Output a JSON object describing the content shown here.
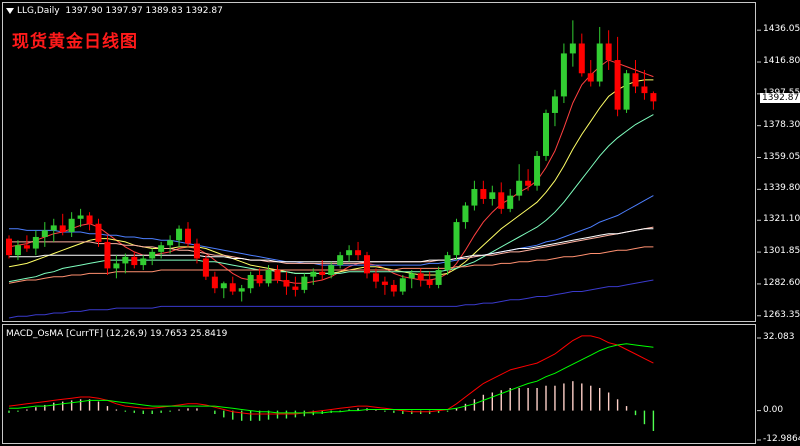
{
  "header": {
    "symbol_label": "LLG,Daily",
    "ohlc": "1397.90 1397.97 1389.83 1392.87",
    "chinese_title": "现货黄金日线图",
    "macd_label": "MACD_OsMA [CurrTF] (12,26,9) 19.7653 25.8419"
  },
  "current_price": "1392.87",
  "price_axis": [
    "1436.05",
    "1416.80",
    "1397.55",
    "1378.30",
    "1359.05",
    "1339.80",
    "1321.10",
    "1301.85",
    "1282.60",
    "1263.35"
  ],
  "macd_axis": [
    "32.083",
    "0.00",
    "-12.9864"
  ],
  "colors": {
    "background": "#000000",
    "bull": "#32cd32",
    "bear": "#ff0000",
    "border": "#c8c8c8"
  },
  "chart_data": {
    "type": "candlestick",
    "title": "",
    "ylim": [
      1263.35,
      1445
    ],
    "candles": [
      [
        1310,
        1312,
        1298,
        1300
      ],
      [
        1300,
        1309,
        1297,
        1306
      ],
      [
        1306,
        1312,
        1302,
        1304
      ],
      [
        1304,
        1315,
        1300,
        1311
      ],
      [
        1311,
        1320,
        1305,
        1315
      ],
      [
        1315,
        1322,
        1308,
        1318
      ],
      [
        1318,
        1325,
        1312,
        1314
      ],
      [
        1314,
        1326,
        1311,
        1322
      ],
      [
        1322,
        1328,
        1317,
        1324
      ],
      [
        1324,
        1326,
        1315,
        1319
      ],
      [
        1319,
        1322,
        1305,
        1308
      ],
      [
        1308,
        1312,
        1288,
        1292
      ],
      [
        1292,
        1300,
        1286,
        1295
      ],
      [
        1295,
        1301,
        1289,
        1299
      ],
      [
        1299,
        1302,
        1292,
        1294
      ],
      [
        1294,
        1300,
        1291,
        1298
      ],
      [
        1298,
        1304,
        1294,
        1302
      ],
      [
        1302,
        1308,
        1298,
        1306
      ],
      [
        1306,
        1312,
        1301,
        1309
      ],
      [
        1309,
        1318,
        1305,
        1316
      ],
      [
        1316,
        1320,
        1305,
        1307
      ],
      [
        1307,
        1310,
        1295,
        1298
      ],
      [
        1298,
        1300,
        1285,
        1287
      ],
      [
        1287,
        1290,
        1277,
        1280
      ],
      [
        1280,
        1284,
        1274,
        1283
      ],
      [
        1283,
        1287,
        1276,
        1278
      ],
      [
        1278,
        1282,
        1272,
        1280
      ],
      [
        1280,
        1290,
        1277,
        1288
      ],
      [
        1288,
        1292,
        1281,
        1283
      ],
      [
        1283,
        1294,
        1281,
        1291
      ],
      [
        1291,
        1294,
        1283,
        1285
      ],
      [
        1285,
        1290,
        1276,
        1281
      ],
      [
        1281,
        1287,
        1275,
        1279
      ],
      [
        1279,
        1289,
        1277,
        1287
      ],
      [
        1287,
        1292,
        1282,
        1290
      ],
      [
        1290,
        1297,
        1285,
        1288
      ],
      [
        1288,
        1296,
        1286,
        1294
      ],
      [
        1294,
        1302,
        1292,
        1300
      ],
      [
        1300,
        1306,
        1296,
        1303
      ],
      [
        1303,
        1308,
        1297,
        1300
      ],
      [
        1300,
        1302,
        1286,
        1289
      ],
      [
        1289,
        1292,
        1280,
        1284
      ],
      [
        1284,
        1287,
        1276,
        1282
      ],
      [
        1282,
        1285,
        1275,
        1278
      ],
      [
        1278,
        1288,
        1276,
        1286
      ],
      [
        1286,
        1291,
        1280,
        1289
      ],
      [
        1289,
        1292,
        1281,
        1285
      ],
      [
        1285,
        1290,
        1280,
        1282
      ],
      [
        1282,
        1293,
        1280,
        1291
      ],
      [
        1291,
        1302,
        1288,
        1300
      ],
      [
        1300,
        1322,
        1297,
        1320
      ],
      [
        1320,
        1332,
        1316,
        1330
      ],
      [
        1330,
        1345,
        1327,
        1340
      ],
      [
        1340,
        1345,
        1331,
        1334
      ],
      [
        1334,
        1342,
        1330,
        1338
      ],
      [
        1338,
        1344,
        1325,
        1328
      ],
      [
        1328,
        1340,
        1326,
        1336
      ],
      [
        1336,
        1355,
        1333,
        1345
      ],
      [
        1345,
        1352,
        1339,
        1342
      ],
      [
        1342,
        1363,
        1339,
        1360
      ],
      [
        1360,
        1388,
        1357,
        1386
      ],
      [
        1386,
        1400,
        1378,
        1396
      ],
      [
        1396,
        1428,
        1392,
        1422
      ],
      [
        1422,
        1442,
        1414,
        1428
      ],
      [
        1428,
        1434,
        1408,
        1410
      ],
      [
        1410,
        1418,
        1402,
        1405
      ],
      [
        1405,
        1438,
        1402,
        1428
      ],
      [
        1428,
        1436,
        1412,
        1418
      ],
      [
        1418,
        1432,
        1384,
        1388
      ],
      [
        1388,
        1412,
        1386,
        1410
      ],
      [
        1410,
        1418,
        1398,
        1402
      ],
      [
        1402,
        1412,
        1394,
        1398
      ],
      [
        1398,
        1399,
        1388,
        1393
      ]
    ],
    "moving_averages": [
      {
        "color": "#ff4040",
        "values": [
          1305,
          1306,
          1307,
          1309,
          1311,
          1313,
          1314,
          1316,
          1318,
          1319,
          1317,
          1313,
          1309,
          1305,
          1302,
          1300,
          1300,
          1301,
          1302,
          1304,
          1305,
          1304,
          1301,
          1297,
          1293,
          1289,
          1286,
          1285,
          1285,
          1285,
          1285,
          1284,
          1283,
          1283,
          1284,
          1285,
          1287,
          1290,
          1293,
          1295,
          1295,
          1294,
          1292,
          1289,
          1287,
          1286,
          1285,
          1285,
          1286,
          1289,
          1295,
          1303,
          1312,
          1320,
          1326,
          1331,
          1334,
          1338,
          1341,
          1345,
          1353,
          1363,
          1377,
          1392,
          1403,
          1409,
          1414,
          1418,
          1416,
          1414,
          1412,
          1410,
          1408
        ]
      },
      {
        "color": "#ffff66",
        "values": [
          1293,
          1294,
          1295,
          1297,
          1299,
          1301,
          1303,
          1305,
          1307,
          1309,
          1310,
          1310,
          1309,
          1308,
          1306,
          1305,
          1304,
          1304,
          1304,
          1305,
          1305,
          1305,
          1304,
          1302,
          1300,
          1298,
          1296,
          1294,
          1293,
          1292,
          1291,
          1290,
          1289,
          1289,
          1289,
          1289,
          1289,
          1290,
          1291,
          1292,
          1293,
          1293,
          1292,
          1291,
          1290,
          1289,
          1288,
          1288,
          1288,
          1289,
          1292,
          1296,
          1301,
          1306,
          1311,
          1316,
          1320,
          1324,
          1328,
          1332,
          1338,
          1345,
          1354,
          1364,
          1373,
          1381,
          1389,
          1396,
          1400,
          1403,
          1405,
          1406,
          1406
        ]
      },
      {
        "color": "#7fffbf",
        "values": [
          1284,
          1285,
          1286,
          1287,
          1289,
          1290,
          1292,
          1293,
          1294,
          1295,
          1296,
          1297,
          1297,
          1297,
          1297,
          1297,
          1297,
          1297,
          1297,
          1297,
          1297,
          1297,
          1296,
          1296,
          1295,
          1294,
          1293,
          1292,
          1291,
          1291,
          1290,
          1290,
          1289,
          1289,
          1289,
          1289,
          1289,
          1289,
          1290,
          1290,
          1290,
          1290,
          1290,
          1290,
          1290,
          1290,
          1290,
          1290,
          1290,
          1291,
          1292,
          1294,
          1296,
          1299,
          1302,
          1305,
          1308,
          1311,
          1314,
          1317,
          1321,
          1326,
          1332,
          1339,
          1346,
          1353,
          1360,
          1366,
          1371,
          1375,
          1379,
          1382,
          1385
        ]
      },
      {
        "color": "#4d7fff",
        "values": [
          1316,
          1316,
          1315,
          1315,
          1315,
          1315,
          1314,
          1314,
          1314,
          1313,
          1313,
          1312,
          1312,
          1311,
          1311,
          1310,
          1310,
          1309,
          1309,
          1308,
          1307,
          1306,
          1305,
          1304,
          1303,
          1302,
          1301,
          1300,
          1299,
          1298,
          1297,
          1296,
          1296,
          1295,
          1295,
          1294,
          1294,
          1294,
          1294,
          1294,
          1294,
          1294,
          1294,
          1294,
          1294,
          1294,
          1294,
          1295,
          1295,
          1296,
          1297,
          1298,
          1299,
          1300,
          1301,
          1302,
          1303,
          1304,
          1305,
          1306,
          1308,
          1309,
          1311,
          1313,
          1315,
          1317,
          1320,
          1322,
          1324,
          1327,
          1330,
          1333,
          1336
        ]
      },
      {
        "color": "#ffb0a0",
        "values": [
          1308,
          1308,
          1308,
          1308,
          1308,
          1308,
          1308,
          1308,
          1308,
          1308,
          1307,
          1307,
          1307,
          1306,
          1306,
          1305,
          1305,
          1304,
          1304,
          1303,
          1303,
          1302,
          1301,
          1300,
          1300,
          1299,
          1298,
          1297,
          1297,
          1296,
          1296,
          1295,
          1295,
          1295,
          1295,
          1295,
          1295,
          1295,
          1295,
          1295,
          1296,
          1296,
          1296,
          1296,
          1296,
          1296,
          1296,
          1296,
          1297,
          1297,
          1298,
          1298,
          1299,
          1300,
          1300,
          1301,
          1302,
          1302,
          1303,
          1304,
          1305,
          1306,
          1307,
          1308,
          1309,
          1310,
          1311,
          1312,
          1313,
          1314,
          1315,
          1316,
          1317
        ]
      },
      {
        "color": "#ffffff",
        "values": [
          1299,
          1299,
          1299,
          1299,
          1300,
          1300,
          1300,
          1300,
          1300,
          1300,
          1300,
          1300,
          1300,
          1300,
          1300,
          1300,
          1300,
          1300,
          1300,
          1300,
          1300,
          1300,
          1299,
          1299,
          1299,
          1298,
          1298,
          1297,
          1297,
          1297,
          1296,
          1296,
          1296,
          1296,
          1296,
          1296,
          1296,
          1296,
          1296,
          1296,
          1296,
          1296,
          1296,
          1296,
          1296,
          1296,
          1296,
          1297,
          1297,
          1297,
          1298,
          1299,
          1300,
          1300,
          1301,
          1302,
          1303,
          1304,
          1304,
          1305,
          1306,
          1307,
          1308,
          1309,
          1310,
          1311,
          1312,
          1313,
          1313,
          1314,
          1315,
          1316,
          1316
        ]
      },
      {
        "color": "#ff9070",
        "values": [
          1283,
          1284,
          1285,
          1285,
          1286,
          1287,
          1287,
          1288,
          1288,
          1289,
          1289,
          1289,
          1290,
          1290,
          1290,
          1290,
          1290,
          1291,
          1291,
          1291,
          1291,
          1291,
          1291,
          1291,
          1291,
          1291,
          1291,
          1291,
          1291,
          1291,
          1291,
          1291,
          1291,
          1291,
          1291,
          1291,
          1291,
          1291,
          1291,
          1291,
          1291,
          1291,
          1291,
          1291,
          1292,
          1292,
          1292,
          1292,
          1292,
          1292,
          1293,
          1293,
          1294,
          1294,
          1294,
          1295,
          1295,
          1296,
          1296,
          1297,
          1297,
          1298,
          1299,
          1299,
          1300,
          1301,
          1301,
          1302,
          1303,
          1303,
          1304,
          1305,
          1305
        ]
      },
      {
        "color": "#3a3acc",
        "values": [
          1262,
          1263,
          1263,
          1264,
          1264,
          1265,
          1265,
          1266,
          1266,
          1267,
          1267,
          1267,
          1268,
          1268,
          1268,
          1268,
          1268,
          1269,
          1269,
          1269,
          1269,
          1269,
          1269,
          1269,
          1269,
          1269,
          1269,
          1269,
          1269,
          1269,
          1269,
          1269,
          1269,
          1269,
          1269,
          1269,
          1269,
          1269,
          1269,
          1269,
          1269,
          1269,
          1269,
          1269,
          1269,
          1269,
          1269,
          1269,
          1269,
          1269,
          1269,
          1270,
          1270,
          1271,
          1271,
          1272,
          1273,
          1273,
          1274,
          1275,
          1275,
          1276,
          1277,
          1278,
          1278,
          1279,
          1280,
          1281,
          1281,
          1282,
          1283,
          1284,
          1285
        ]
      }
    ],
    "macd": {
      "ylim": [
        -12.9864,
        32.083
      ],
      "histogram": [
        -1,
        -0.5,
        0.5,
        1.5,
        2.5,
        3.5,
        4,
        4.5,
        5,
        5,
        4,
        2,
        0.5,
        -0.5,
        -1,
        -1.5,
        -1.5,
        -1,
        -0.5,
        0.5,
        1,
        1,
        0,
        -1.5,
        -3,
        -4,
        -4.5,
        -4.5,
        -4.5,
        -4,
        -3.5,
        -3.5,
        -3,
        -2.5,
        -2,
        -1.5,
        -1,
        -0.5,
        0.5,
        1,
        1,
        0.5,
        -0.5,
        -1,
        -1.5,
        -1.5,
        -1.5,
        -1.5,
        -1,
        -0.5,
        1,
        3,
        5,
        7,
        8,
        9,
        10,
        10,
        10,
        10,
        11,
        11,
        12,
        13,
        12,
        11,
        10,
        8,
        5,
        2,
        -2,
        -6,
        -9
      ],
      "macd_line": [
        2,
        2.5,
        3,
        3.5,
        4,
        4.5,
        5,
        5.5,
        6,
        6,
        5.5,
        4.5,
        3,
        2,
        1.5,
        1,
        1,
        1.5,
        2,
        2.5,
        3,
        3,
        2.5,
        1.5,
        0.5,
        -0.5,
        -1,
        -1.5,
        -1.5,
        -1.5,
        -1.5,
        -1.5,
        -1.5,
        -1,
        -0.5,
        0,
        0.5,
        1,
        1.5,
        2,
        2,
        1.5,
        1,
        0.5,
        0,
        -0.5,
        -0.5,
        -0.5,
        0,
        0.5,
        3,
        6,
        9,
        12,
        14,
        16,
        18,
        19,
        20,
        21,
        23,
        25,
        28,
        31,
        33,
        33,
        32,
        30,
        29,
        27,
        25,
        23,
        21
      ],
      "signal_line": [
        1,
        1,
        1.5,
        2,
        2,
        2.5,
        3,
        3.5,
        4,
        4.5,
        4.5,
        4.5,
        4,
        3.5,
        3,
        2.5,
        2,
        2,
        2,
        2,
        2,
        2,
        2,
        2,
        1.5,
        1,
        0.5,
        0,
        -0.5,
        -0.5,
        -1,
        -1,
        -1,
        -1,
        -1,
        -1,
        -0.5,
        -0.5,
        0,
        0,
        0.5,
        0.5,
        0.5,
        0.5,
        0.5,
        0.5,
        0.5,
        0.5,
        0.5,
        0.5,
        1,
        2,
        3,
        4.5,
        6,
        7.5,
        9,
        10.5,
        12,
        13,
        15,
        16.5,
        18.5,
        20.5,
        22.5,
        24.5,
        26.5,
        28,
        29,
        29.5,
        29,
        28.5,
        28
      ]
    }
  }
}
